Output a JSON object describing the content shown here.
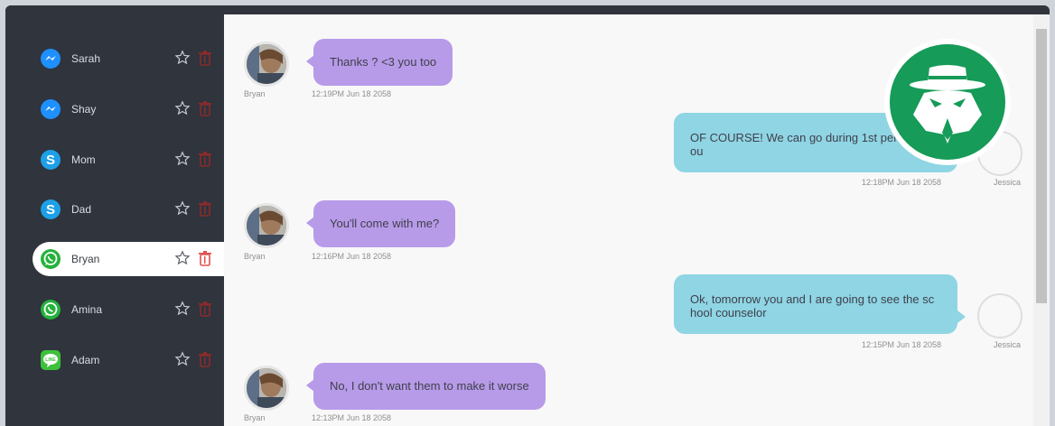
{
  "contacts": [
    {
      "name": "Sarah",
      "app": "messenger-icon"
    },
    {
      "name": "Shay",
      "app": "messenger-icon"
    },
    {
      "name": "Mom",
      "app": "skype-icon"
    },
    {
      "name": "Dad",
      "app": "skype-icon"
    },
    {
      "name": "Bryan",
      "app": "whatsapp-icon",
      "active": true
    },
    {
      "name": "Amina",
      "app": "whatsapp-icon"
    },
    {
      "name": "Adam",
      "app": "line-icon"
    }
  ],
  "messages": [
    {
      "direction": "in",
      "sender": "Bryan",
      "text": "Thanks ? <3 you too",
      "time": "12:19PM Jun 18 2058"
    },
    {
      "direction": "out",
      "sender": "Jessica",
      "text_line1": "OF COURSE! We can go during 1st perio",
      "text_line2": "ou",
      "time": "12:18PM Jun 18 2058"
    },
    {
      "direction": "in",
      "sender": "Bryan",
      "text": "You'll come with me?",
      "time": "12:16PM Jun 18 2058"
    },
    {
      "direction": "out",
      "sender": "Jessica",
      "text_line1": "Ok, tomorrow you and I are going to see the sc",
      "text_line2": "hool counselor",
      "time": "12:15PM Jun 18 2058"
    },
    {
      "direction": "in",
      "sender": "Bryan",
      "text": "No, I don't want them to make it worse",
      "time": "12:13PM Jun 18 2058"
    }
  ],
  "colors": {
    "sidebar": "#2f343d",
    "incoming_bubble": "#b79be9",
    "outgoing_bubble": "#8fd5e4",
    "spy_badge": "#169b58",
    "trash_active": "#e0524f",
    "trash_inactive": "#8a2b2b"
  }
}
